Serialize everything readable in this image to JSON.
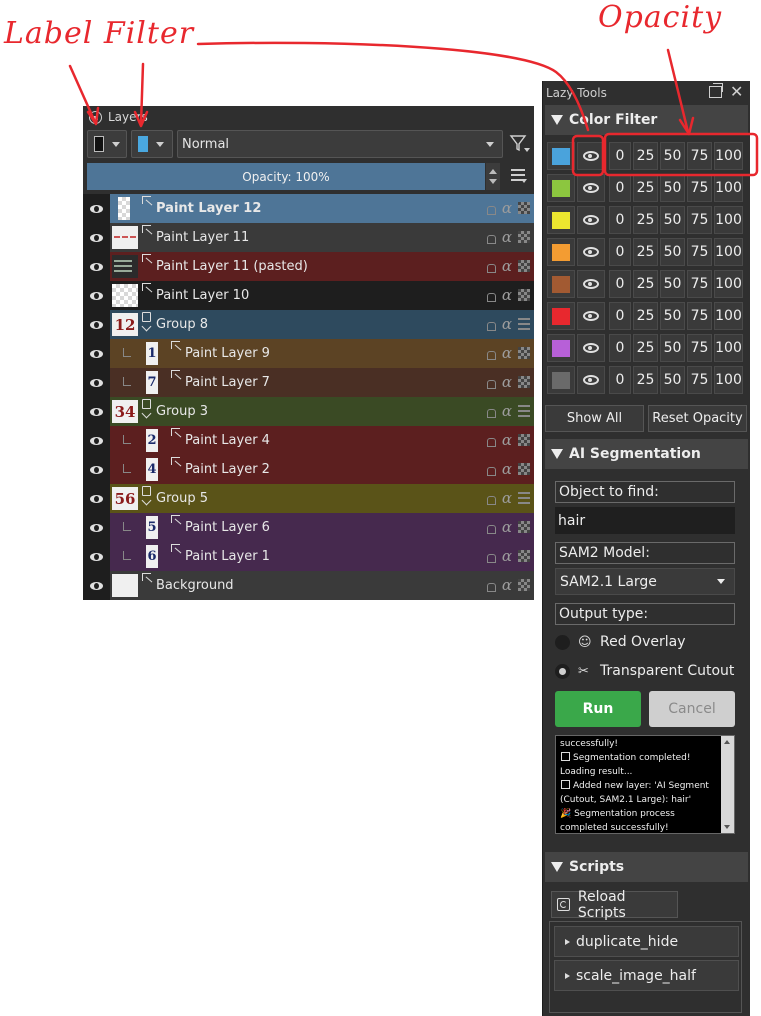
{
  "annotations": {
    "label_filter": "Label Filter",
    "opacity": "Opacity"
  },
  "layers_panel": {
    "title": "Layers",
    "blend_mode": "Normal",
    "opacity_label": "Opacity:  100%",
    "icons": [
      "lock-icon",
      "label-color-icon",
      "filter-icon",
      "menu-icon"
    ],
    "layers": [
      {
        "name": "Paint Layer 12",
        "type": "paint",
        "bg": "#4e7597",
        "selected": true,
        "thumb": "checker-narrow",
        "thumb_text": ""
      },
      {
        "name": "Paint Layer 11",
        "type": "paint",
        "bg": "#3a3a3a",
        "thumb": "wave",
        "thumb_text": ""
      },
      {
        "name": "Paint Layer 11 (pasted)",
        "type": "paint",
        "bg": "#5c1f1f",
        "thumb": "dark",
        "thumb_text": ""
      },
      {
        "name": "Paint Layer 10",
        "type": "paint",
        "bg": "#1e1e1e",
        "thumb": "checker",
        "thumb_text": ""
      },
      {
        "name": "Group 8",
        "type": "group",
        "bg": "#2e4a5e",
        "thumb": "group",
        "thumb_text": "12"
      },
      {
        "name": "Paint Layer 9",
        "type": "paint",
        "bg": "#5c4324",
        "child": true,
        "thumb": "narrow",
        "thumb_text": "1"
      },
      {
        "name": "Paint Layer 7",
        "type": "paint",
        "bg": "#4a2f24",
        "child": true,
        "thumb": "narrow",
        "thumb_text": "7"
      },
      {
        "name": "Group 3",
        "type": "group",
        "bg": "#3a4a24",
        "thumb": "group",
        "thumb_text": "34"
      },
      {
        "name": "Paint Layer 4",
        "type": "paint",
        "bg": "#5c1f1f",
        "child": true,
        "thumb": "narrow",
        "thumb_text": "2"
      },
      {
        "name": "Paint Layer 2",
        "type": "paint",
        "bg": "#5c1f1f",
        "child": true,
        "thumb": "narrow",
        "thumb_text": "4"
      },
      {
        "name": "Group 5",
        "type": "group",
        "bg": "#5a5318",
        "thumb": "group",
        "thumb_text": "56"
      },
      {
        "name": "Paint Layer 6",
        "type": "paint",
        "bg": "#46294e",
        "child": true,
        "thumb": "narrow",
        "thumb_text": "5"
      },
      {
        "name": "Paint Layer 1",
        "type": "paint",
        "bg": "#46294e",
        "child": true,
        "thumb": "narrow",
        "thumb_text": "6"
      },
      {
        "name": "Background",
        "type": "paint",
        "bg": "#3a3a3a",
        "thumb": "white",
        "thumb_text": ""
      }
    ]
  },
  "lazy_tools": {
    "title": "Lazy Tools",
    "color_filter": {
      "heading": "Color Filter",
      "opacity_values": [
        "0",
        "25",
        "50",
        "75",
        "100"
      ],
      "colors": [
        "#4aa3dc",
        "#8cc63f",
        "#ece62f",
        "#f39c32",
        "#a25a32",
        "#e8282e",
        "#b760d8",
        "#6a6a6a"
      ],
      "show_all": "Show All",
      "reset_opacity": "Reset Opacity"
    },
    "ai_segmentation": {
      "heading": "AI Segmentation",
      "object_label": "Object to find:",
      "object_value": "hair",
      "model_label": "SAM2 Model:",
      "model_value": "SAM2.1 Large",
      "output_label": "Output type:",
      "option_red": "Red Overlay",
      "option_cutout": "Transparent Cutout",
      "selected_option": "Transparent Cutout",
      "run": "Run",
      "cancel": "Cancel",
      "log": [
        {
          "text": "successfully!",
          "check": false
        },
        {
          "text": "Segmentation completed!",
          "check": true
        },
        {
          "text": "Loading result...",
          "check": false
        },
        {
          "text": "Added new layer: 'AI Segment",
          "check": true
        },
        {
          "text": "(Cutout, SAM2.1 Large): hair'",
          "check": false
        },
        {
          "text": "🎉 Segmentation process",
          "check": false
        },
        {
          "text": "completed successfully!",
          "check": false
        }
      ]
    },
    "scripts": {
      "heading": "Scripts",
      "reload": "Reload Scripts",
      "items": [
        "duplicate_hide",
        "scale_image_half"
      ]
    }
  }
}
